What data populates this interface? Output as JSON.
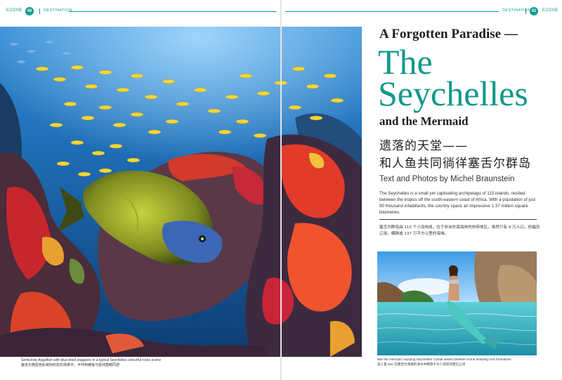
{
  "header": {
    "left": {
      "brand": "EZONE",
      "page": "40",
      "section": "DESTINATION"
    },
    "right": {
      "brand": "EZONE",
      "page": "41",
      "section": "DESTINATION"
    }
  },
  "hero": {
    "caption_en": "Semicircle Angelfish with blue-lined snappers in a typical Seychelles colourful rocks scene",
    "caption_cn": "塞舌尔典型色彩缤纷的岩石场景中，半环刺蝶鱼与蓝线笛鲷同游"
  },
  "article": {
    "kicker": "A Forgotten Paradise —",
    "title_line1": "The",
    "title_line2": "Seychelles",
    "subtitle": "and the Mermaid",
    "title_cn_line1": "遗落的天堂——",
    "title_cn_line2": "和人鱼共同徜徉塞舌尔群岛",
    "byline": "Text and Photos by Michel Braunstein",
    "intro_en": "The Seychelles is a small yet captivating archipelago of 115 islands, nestled between the tropics off the south-eastern coast of Africa. With a population of just 90 thousand inhabitants, the country spans an impressive 1.37 million square kilometres.",
    "intro_cn": "塞舌尔群岛由 115 个小岛构成，位于非洲东南海岸的热带地区。虽然只有 9 万人口，但幅员辽阔，横跨逾 137 万平方公里的海域。"
  },
  "photo2": {
    "caption_en": "Mor the mermaid, enjoying Seychelles' crystal waters between some amazing rock formations",
    "caption_cn": "美人鱼 Mor 在塞舌尔清澈的海水中畅游于令人惊叹的岩石之间"
  },
  "colors": {
    "accent": "#12988c",
    "text": "#1e1e1e"
  }
}
